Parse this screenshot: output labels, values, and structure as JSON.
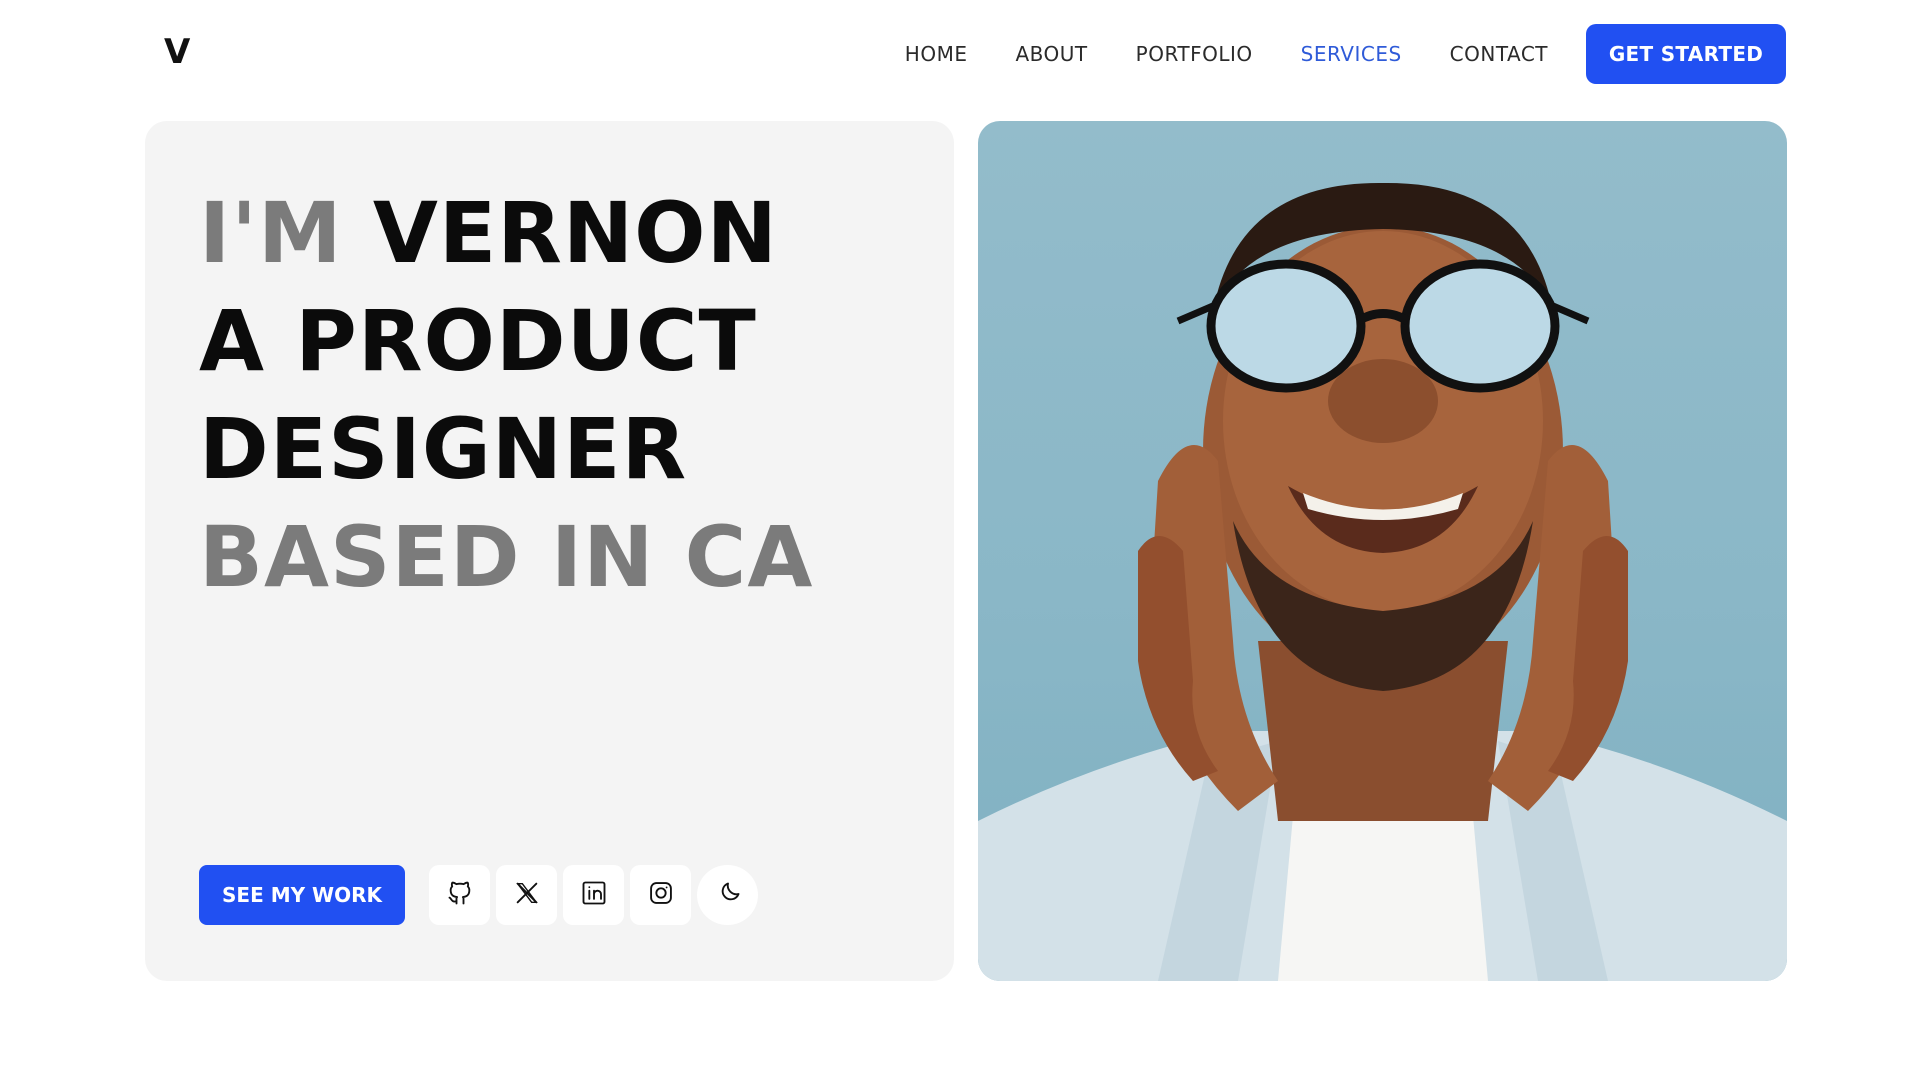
{
  "nav": {
    "logo": "V",
    "items": [
      {
        "label": "HOME",
        "active": false
      },
      {
        "label": "ABOUT",
        "active": false
      },
      {
        "label": "PORTFOLIO",
        "active": false
      },
      {
        "label": "SERVICES",
        "active": true
      },
      {
        "label": "CONTACT",
        "active": false
      }
    ],
    "cta_label": "GET STARTED"
  },
  "hero": {
    "line1_muted": "I'M",
    "line1_name": "VERNON",
    "line2": "A PRODUCT",
    "line3": "DESIGNER",
    "line4": "BASED IN CA",
    "button_label": "SEE MY WORK",
    "socials": [
      "github-icon",
      "x-icon",
      "linkedin-icon",
      "instagram-icon",
      "moon-icon"
    ]
  },
  "colors": {
    "accent": "#2150f2",
    "active_nav": "#2f5bd8",
    "muted_text": "#7b7b7b",
    "card_bg": "#f4f4f4",
    "photo_bg": "#8ab7c7"
  }
}
